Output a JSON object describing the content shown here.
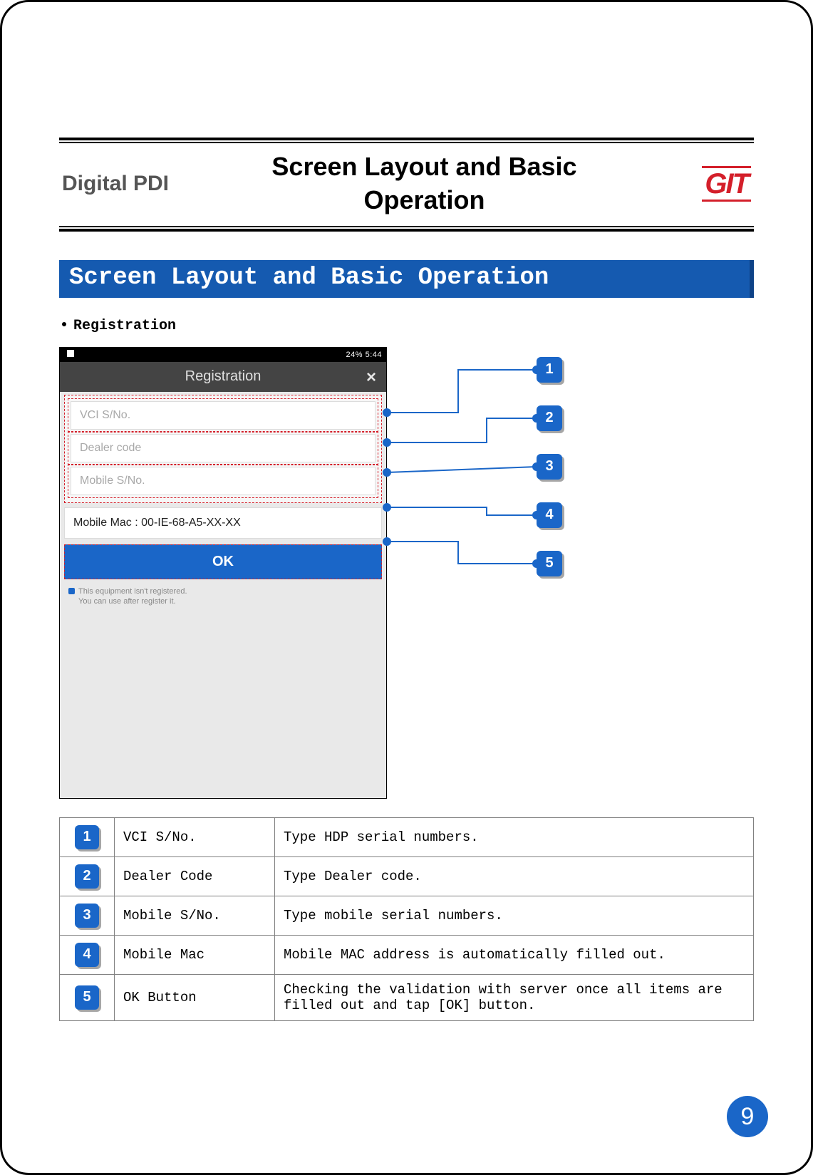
{
  "header": {
    "left": "Digital PDI",
    "center": "Screen Layout and Basic Operation",
    "logo_text": "GIT"
  },
  "section_title": "Screen Layout and Basic Operation",
  "bullet": "Registration",
  "phone": {
    "status_text": "24%   5:44",
    "title": "Registration",
    "close_glyph": "×",
    "fields": {
      "vci": "VCI S/No.",
      "dealer": "Dealer code",
      "mobile": "Mobile S/No.",
      "mac": "Mobile Mac : 00-IE-68-A5-XX-XX"
    },
    "ok_label": "OK",
    "notice_line1": "This equipment isn't registered.",
    "notice_line2": "You can use after register it."
  },
  "callouts": [
    "1",
    "2",
    "3",
    "4",
    "5"
  ],
  "table": [
    {
      "num": "1",
      "name": "VCI S/No.",
      "desc": "Type HDP serial numbers."
    },
    {
      "num": "2",
      "name": "Dealer Code",
      "desc": "Type Dealer code."
    },
    {
      "num": "3",
      "name": "Mobile S/No.",
      "desc": "Type mobile serial numbers."
    },
    {
      "num": "4",
      "name": "Mobile Mac",
      "desc": "Mobile MAC address is automatically filled out."
    },
    {
      "num": "5",
      "name": "OK Button",
      "desc": "Checking the validation with server once all items are filled out and tap [OK] button."
    }
  ],
  "page_number": "9"
}
